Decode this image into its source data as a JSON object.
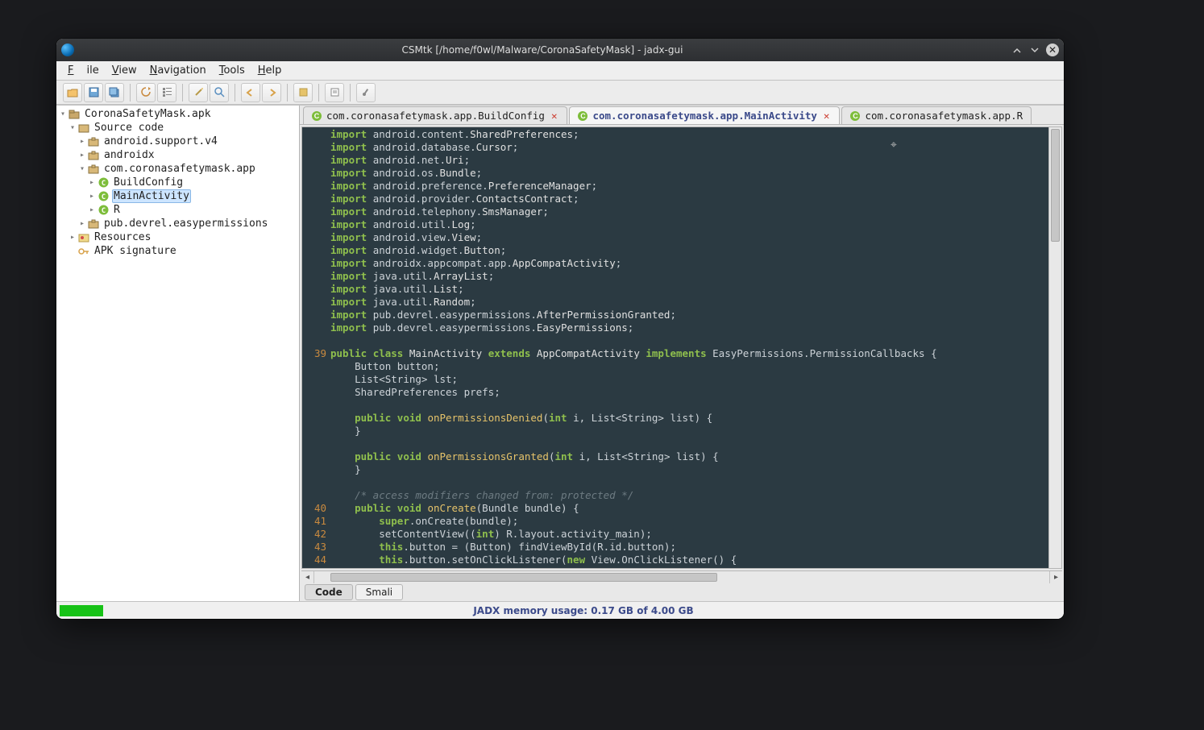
{
  "window": {
    "title": "CSMtk [/home/f0wl/Malware/CoronaSafetyMask] - jadx-gui"
  },
  "menu": {
    "file": "File",
    "view": "View",
    "nav": "Navigation",
    "tools": "Tools",
    "help": "Help"
  },
  "tree": {
    "root": "CoronaSafetyMask.apk",
    "source": "Source code",
    "pkg_support": "android.support.v4",
    "pkg_androidx": "androidx",
    "pkg_app": "com.coronasafetymask.app",
    "cls_build": "BuildConfig",
    "cls_main": "MainActivity",
    "cls_r": "R",
    "pkg_pub": "pub.devrel.easypermissions",
    "resources": "Resources",
    "signature": "APK signature"
  },
  "tabs": {
    "t1": "com.coronasafetymask.app.BuildConfig",
    "t2": "com.coronasafetymask.app.MainActivity",
    "t3": "com.coronasafetymask.app.R"
  },
  "bottom_tabs": {
    "code": "Code",
    "smali": "Smali"
  },
  "status": {
    "mem": "JADX memory usage: 0.17 GB of 4.00 GB"
  },
  "line_numbers": {
    "l39": "39",
    "l40": "40",
    "l41": "41",
    "l42": "42",
    "l43": "43",
    "l44": "44"
  },
  "code": {
    "imports": [
      "android.content.SharedPreferences;",
      "android.database.Cursor;",
      "android.net.Uri;",
      "android.os.Bundle;",
      "android.preference.PreferenceManager;",
      "android.provider.ContactsContract;",
      "android.telephony.SmsManager;",
      "android.util.Log;",
      "android.view.View;",
      "android.widget.Button;",
      "androidx.appcompat.app.AppCompatActivity;",
      "java.util.ArrayList;",
      "java.util.List;",
      "java.util.Random;",
      "pub.devrel.easypermissions.AfterPermissionGranted;",
      "pub.devrel.easypermissions.EasyPermissions;"
    ],
    "class_decl": {
      "prefix": "public class ",
      "name": "MainActivity",
      "extends": " extends ",
      "base": "AppCompatActivity",
      "implements": " implements ",
      "iface": "EasyPermissions.PermissionCallbacks {"
    },
    "fields": [
      "Button button;",
      "List<String> lst;",
      "SharedPreferences prefs;"
    ],
    "m1": {
      "sig": "public void ",
      "name": "onPermissionsDenied",
      "args": "(int i, List<String> list) {"
    },
    "m2": {
      "sig": "public void ",
      "name": "onPermissionsGranted",
      "args": "(int i, List<String> list) {"
    },
    "comment": "/* access modifiers changed from: protected */",
    "m3": {
      "sig": "public void ",
      "name": "onCreate",
      "args": "(Bundle bundle) {"
    },
    "body": [
      "super.onCreate(bundle);",
      "setContentView((int) R.layout.activity_main);",
      "this.button = (Button) findViewById(R.id.button);",
      "this.button.setOnClickListener(new View.OnClickListener() {"
    ]
  }
}
